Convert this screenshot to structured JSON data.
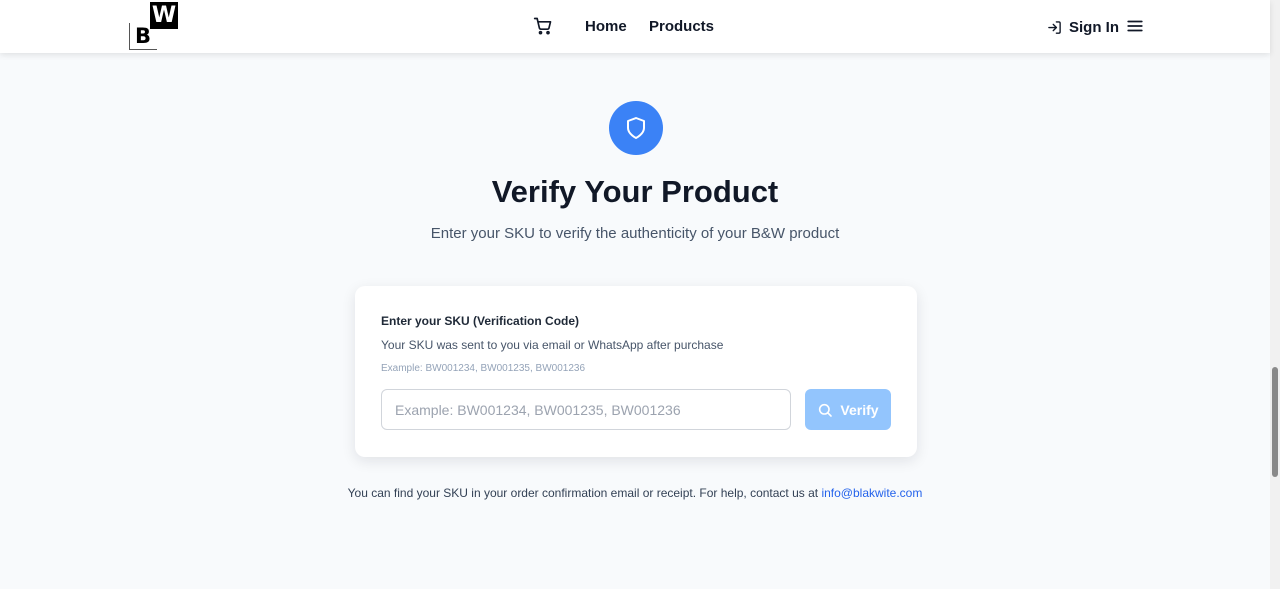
{
  "header": {
    "logo": {
      "top_letter": "W",
      "bottom_letter": "B"
    },
    "nav": {
      "home": "Home",
      "products": "Products"
    },
    "sign_in": "Sign In",
    "icons": {
      "cart": "cart-icon",
      "sign_in": "log-in-icon",
      "menu": "hamburger-menu-icon"
    }
  },
  "hero": {
    "icon": "shield-icon",
    "title": "Verify Your Product",
    "subtitle": "Enter your SKU to verify the authenticity of your B&W product"
  },
  "form": {
    "label": "Enter your SKU (Verification Code)",
    "help": "Your SKU was sent to you via email or WhatsApp after purchase",
    "example": "Example: BW001234, BW001235, BW001236",
    "input_value": "",
    "input_placeholder": "Example: BW001234, BW001235, BW001236",
    "verify_label": "Verify",
    "verify_icon": "search-icon"
  },
  "footer": {
    "note": "You can find your SKU in your order confirmation email or receipt. For help, contact us at ",
    "email": "info@blakwite.com"
  },
  "colors": {
    "accent": "#3b82f6",
    "button_disabled": "#93c5fd",
    "link": "#2563eb",
    "background": "#f8fafc"
  }
}
